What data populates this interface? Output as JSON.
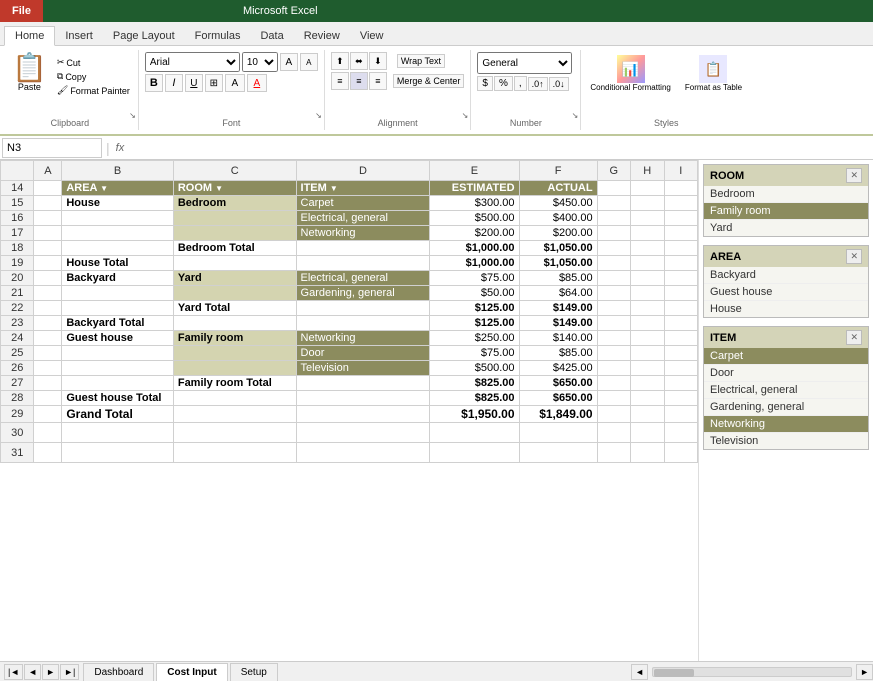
{
  "titlebar": {
    "file_label": "File"
  },
  "tabs": [
    "Home",
    "Insert",
    "Page Layout",
    "Formulas",
    "Data",
    "Review",
    "View"
  ],
  "active_tab": "Home",
  "ribbon": {
    "clipboard_group": "Clipboard",
    "paste_label": "Paste",
    "cut_label": "Cut",
    "copy_label": "Copy",
    "format_painter_label": "Format Painter",
    "font_group": "Font",
    "font_name": "Arial",
    "font_size": "10",
    "alignment_group": "Alignment",
    "wrap_text_label": "Wrap Text",
    "merge_center_label": "Merge & Center",
    "number_group": "Number",
    "number_format": "General",
    "styles_group": "Styles",
    "conditional_formatting_label": "Conditional Formatting",
    "format_as_table_label": "Format as Table"
  },
  "formula_bar": {
    "name_box": "N3",
    "fx": "fx"
  },
  "columns": {
    "row_num": "",
    "B": "B",
    "C": "C",
    "D": "D",
    "E": "E",
    "F": "F",
    "G": "G",
    "H": "H",
    "I": "I"
  },
  "col_headers_display": [
    "",
    "A",
    "B",
    "C",
    "D",
    "E",
    "F",
    "G",
    "H",
    "I"
  ],
  "table_headers": {
    "area": "AREA",
    "room": "ROOM",
    "item": "ITEM",
    "estimated": "ESTIMATED",
    "actual": "ACTUAL"
  },
  "rows": [
    {
      "num": 14,
      "area": "AREA",
      "room": "ROOM",
      "item": "ITEM",
      "estimated": "ESTIMATED",
      "actual": "ACTUAL",
      "is_header": true
    },
    {
      "num": 15,
      "area": "House",
      "room": "Bedroom",
      "item": "Carpet",
      "estimated": "$300.00",
      "actual": "$450.00",
      "is_item": true
    },
    {
      "num": 16,
      "area": "",
      "room": "",
      "item": "Electrical, general",
      "estimated": "$500.00",
      "actual": "$400.00",
      "is_item": true
    },
    {
      "num": 17,
      "area": "",
      "room": "",
      "item": "Networking",
      "estimated": "$200.00",
      "actual": "$200.00",
      "is_item": true
    },
    {
      "num": 18,
      "area": "",
      "room": "Bedroom Total",
      "item": "",
      "estimated": "$1,000.00",
      "actual": "$1,050.00",
      "is_subtotal": true
    },
    {
      "num": 19,
      "area": "House Total",
      "room": "",
      "item": "",
      "estimated": "$1,000.00",
      "actual": "$1,050.00",
      "is_area_total": true
    },
    {
      "num": 20,
      "area": "Backyard",
      "room": "Yard",
      "item": "Electrical, general",
      "estimated": "$75.00",
      "actual": "$85.00",
      "is_item": true
    },
    {
      "num": 21,
      "area": "",
      "room": "",
      "item": "Gardening, general",
      "estimated": "$50.00",
      "actual": "$64.00",
      "is_item": true
    },
    {
      "num": 22,
      "area": "",
      "room": "Yard Total",
      "item": "",
      "estimated": "$125.00",
      "actual": "$149.00",
      "is_subtotal": true
    },
    {
      "num": 23,
      "area": "Backyard Total",
      "room": "",
      "item": "",
      "estimated": "$125.00",
      "actual": "$149.00",
      "is_area_total": true
    },
    {
      "num": 24,
      "area": "Guest house",
      "room": "Family room",
      "item": "Networking",
      "estimated": "$250.00",
      "actual": "$140.00",
      "is_item": true
    },
    {
      "num": 25,
      "area": "",
      "room": "",
      "item": "Door",
      "estimated": "$75.00",
      "actual": "$85.00",
      "is_item": true
    },
    {
      "num": 26,
      "area": "",
      "room": "",
      "item": "Television",
      "estimated": "$500.00",
      "actual": "$425.00",
      "is_item": true
    },
    {
      "num": 27,
      "area": "",
      "room": "Family room Total",
      "item": "",
      "estimated": "$825.00",
      "actual": "$650.00",
      "is_subtotal": true
    },
    {
      "num": 28,
      "area": "Guest house Total",
      "room": "",
      "item": "",
      "estimated": "$825.00",
      "actual": "$650.00",
      "is_area_total": true
    },
    {
      "num": 29,
      "area": "Grand Total",
      "room": "",
      "item": "",
      "estimated": "$1,950.00",
      "actual": "$1,849.00",
      "is_grand_total": true
    },
    {
      "num": 30,
      "area": "",
      "room": "",
      "item": "",
      "estimated": "",
      "actual": "",
      "is_empty": true
    },
    {
      "num": 31,
      "area": "",
      "room": "",
      "item": "",
      "estimated": "",
      "actual": "",
      "is_empty": true
    }
  ],
  "slicers": [
    {
      "id": "room",
      "title": "ROOM",
      "items": [
        {
          "label": "Bedroom",
          "selected": false
        },
        {
          "label": "Family room",
          "selected": true
        },
        {
          "label": "Yard",
          "selected": false
        }
      ]
    },
    {
      "id": "area",
      "title": "AREA",
      "items": [
        {
          "label": "Backyard",
          "selected": false
        },
        {
          "label": "Guest house",
          "selected": false
        },
        {
          "label": "House",
          "selected": false
        }
      ]
    },
    {
      "id": "item",
      "title": "ITEM",
      "items": [
        {
          "label": "Carpet",
          "selected": false
        },
        {
          "label": "Door",
          "selected": false
        },
        {
          "label": "Electrical, general",
          "selected": false
        },
        {
          "label": "Gardening, general",
          "selected": false
        },
        {
          "label": "Networking",
          "selected": false
        },
        {
          "label": "Television",
          "selected": false
        }
      ]
    }
  ],
  "tabs_bar": {
    "tabs": [
      "Dashboard",
      "Cost Input",
      "Setup"
    ],
    "active": "Cost Input"
  }
}
